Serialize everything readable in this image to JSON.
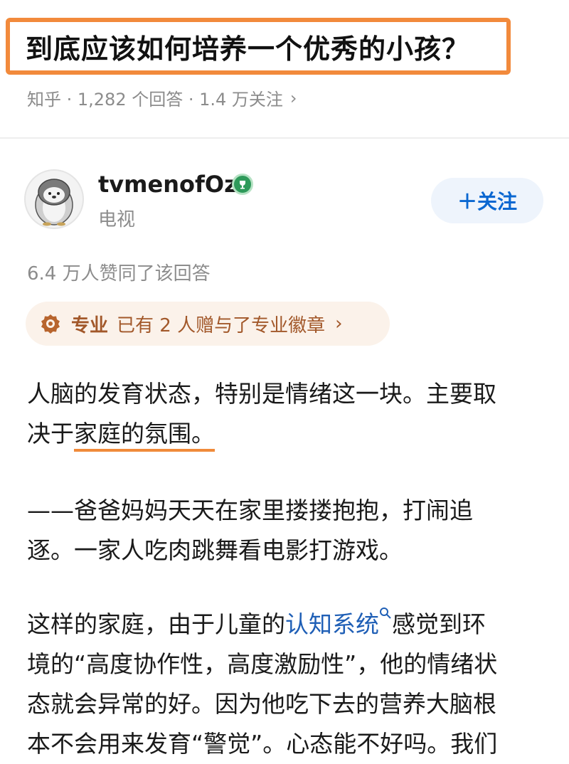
{
  "question": {
    "title": "到底应该如何培养一个优秀的小孩？",
    "meta": "知乎 · 1,282 个回答 · 1.4 万关注",
    "meta_chevron": "›"
  },
  "author": {
    "name": "tvmenofOz",
    "subtitle": "电视",
    "follow_label": "＋关注",
    "avatar_icon": "penguin-avatar",
    "badge_icon": "trophy-badge-icon"
  },
  "answer": {
    "likes_text": "6.4 万人赞同了该回答",
    "pro_badge": {
      "label": "专业",
      "desc": "已有 2 人赠与了专业徽章",
      "chevron": "›"
    },
    "para1": {
      "line1": "人脑的发育状态，特别是情绪这一块。主要取",
      "line2_pre": "决于",
      "line2_underlined": "家庭的氛围。"
    },
    "para2": {
      "line1": "——爸爸妈妈天天在家里搂搂抱抱，打闹追",
      "line2": "逐。一家人吃肉跳舞看电影打游戏。"
    },
    "para3": {
      "line1_pre": "这样的家庭，由于儿童的",
      "line1_link": "认知系统",
      "line1_post": "感觉到环",
      "line2": "境的“高度协作性，高度激励性”，他的情绪状",
      "line3": "态就会异常的好。因为他吃下去的营养大脑根",
      "line4": "本不会用来发育“警觉”。心态能不好吗。我们"
    }
  },
  "colors": {
    "highlight_border": "#f28a3c",
    "link": "#1f5fb6",
    "follow_bg": "#eef4fc",
    "follow_text": "#0a67d1",
    "pro_bg": "#fbf2ea",
    "pro_text": "#a2582a"
  }
}
